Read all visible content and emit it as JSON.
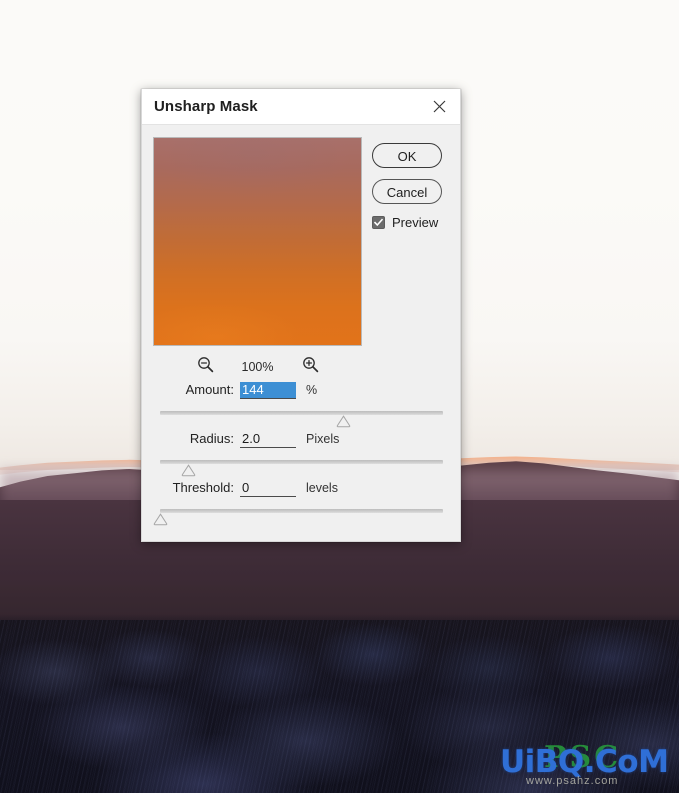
{
  "background": {
    "scene_description": "dusk-lit rocky lava field with distant ridgeline",
    "sky_color": "#fbfaf8",
    "ridge_color": "#4b3440",
    "rim_light_color": "#ff9250",
    "foreground_color": "#13121e"
  },
  "watermark": {
    "main": "UiBQ.CoM",
    "overlay": "PSC",
    "sub": "www.psahz.com"
  },
  "dialog": {
    "title": "Unsharp Mask",
    "close_icon": "close-icon",
    "preview": {
      "gradient_top": "#a8706a",
      "gradient_bottom": "#e2731a"
    },
    "buttons": {
      "ok": "OK",
      "cancel": "Cancel"
    },
    "preview_checkbox": {
      "label": "Preview",
      "checked": true,
      "check_icon": "check-icon"
    },
    "zoom": {
      "out_icon": "zoom-out-icon",
      "in_icon": "zoom-in-icon",
      "level": "100%"
    },
    "fields": [
      {
        "label": "Amount:",
        "value": "144",
        "unit": "%",
        "selected": true,
        "slider_percent": 65,
        "highlight_color": "#3d8fd4"
      },
      {
        "label": "Radius:",
        "value": "2.0",
        "unit": "Pixels",
        "selected": false,
        "slider_percent": 10,
        "highlight_color": "#3d8fd4"
      },
      {
        "label": "Threshold:",
        "value": "0",
        "unit": "levels",
        "selected": false,
        "slider_percent": 0,
        "highlight_color": "#3d8fd4"
      }
    ]
  }
}
